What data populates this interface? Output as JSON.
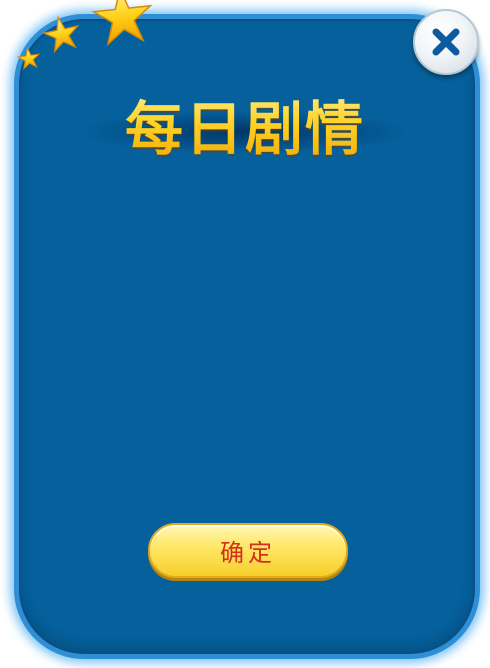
{
  "dialog": {
    "title": "每日剧情",
    "confirm_label": "确定"
  },
  "icons": {
    "close": "close-x-icon",
    "stars": "star-icon"
  },
  "colors": {
    "panel_fill": "#05609b",
    "panel_border": "#2f8fd6",
    "panel_glow": "#7fc4f4",
    "title_gold": "#ffd21a",
    "button_yellow": "#ffe86a",
    "button_text": "#d2321c",
    "close_x": "#0c5aa0"
  }
}
